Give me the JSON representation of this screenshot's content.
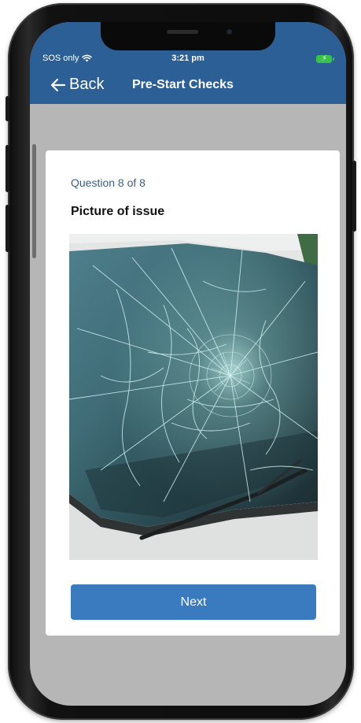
{
  "status_bar": {
    "carrier": "SOS only",
    "time": "3:21 pm",
    "wifi_icon": "wifi-icon",
    "battery_icon": "battery-charging-icon"
  },
  "nav": {
    "back_label": "Back",
    "back_icon": "arrow-left-icon",
    "title": "Pre-Start Checks"
  },
  "question": {
    "counter": "Question 8 of 8",
    "title": "Picture of issue",
    "image_subject": "cracked-windshield-photo"
  },
  "actions": {
    "next_label": "Next"
  },
  "colors": {
    "header": "#2c5f95",
    "primary_button": "#3a7abe",
    "background": "#b6b6b6",
    "battery": "#38c44a",
    "counter_text": "#3c5f86"
  }
}
